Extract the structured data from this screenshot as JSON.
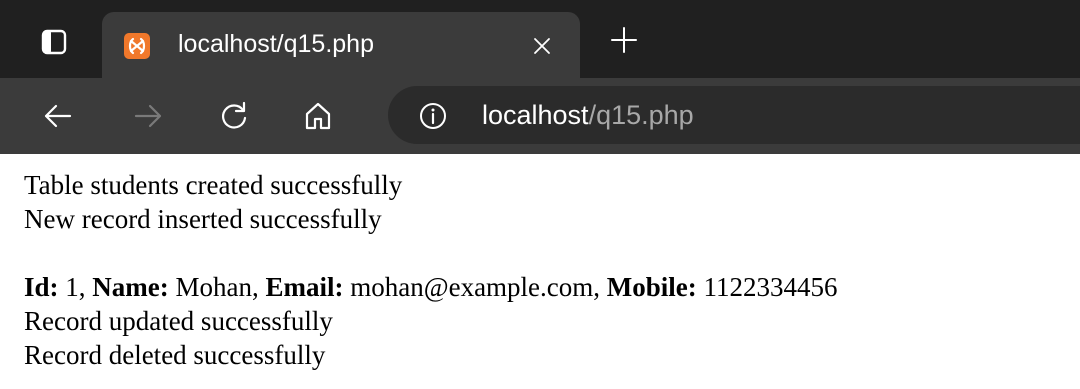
{
  "tab": {
    "title": "localhost/q15.php"
  },
  "address_bar": {
    "host": "localhost",
    "path": "/q15.php"
  },
  "page": {
    "lines": [
      "Table students created successfully",
      "New record inserted successfully"
    ],
    "record": {
      "id_label": "Id:",
      "id_value": " 1, ",
      "name_label": "Name:",
      "name_value": " Mohan, ",
      "email_label": "Email:",
      "email_value": " mohan@example.com, ",
      "mobile_label": "Mobile:",
      "mobile_value": " 1122334456"
    },
    "after_lines": [
      "Record updated successfully",
      "Record deleted successfully"
    ]
  },
  "icons": {
    "tab_actions": "tab-actions-icon",
    "favicon": "xampp-favicon",
    "close": "close-icon",
    "new_tab": "plus-icon",
    "back": "back-arrow-icon",
    "forward": "forward-arrow-icon",
    "refresh": "refresh-icon",
    "home": "home-icon",
    "info": "info-icon"
  },
  "colors": {
    "tabstrip_bg": "#202020",
    "active_tab_bg": "#3b3b3b",
    "favicon": "#f0782b"
  }
}
